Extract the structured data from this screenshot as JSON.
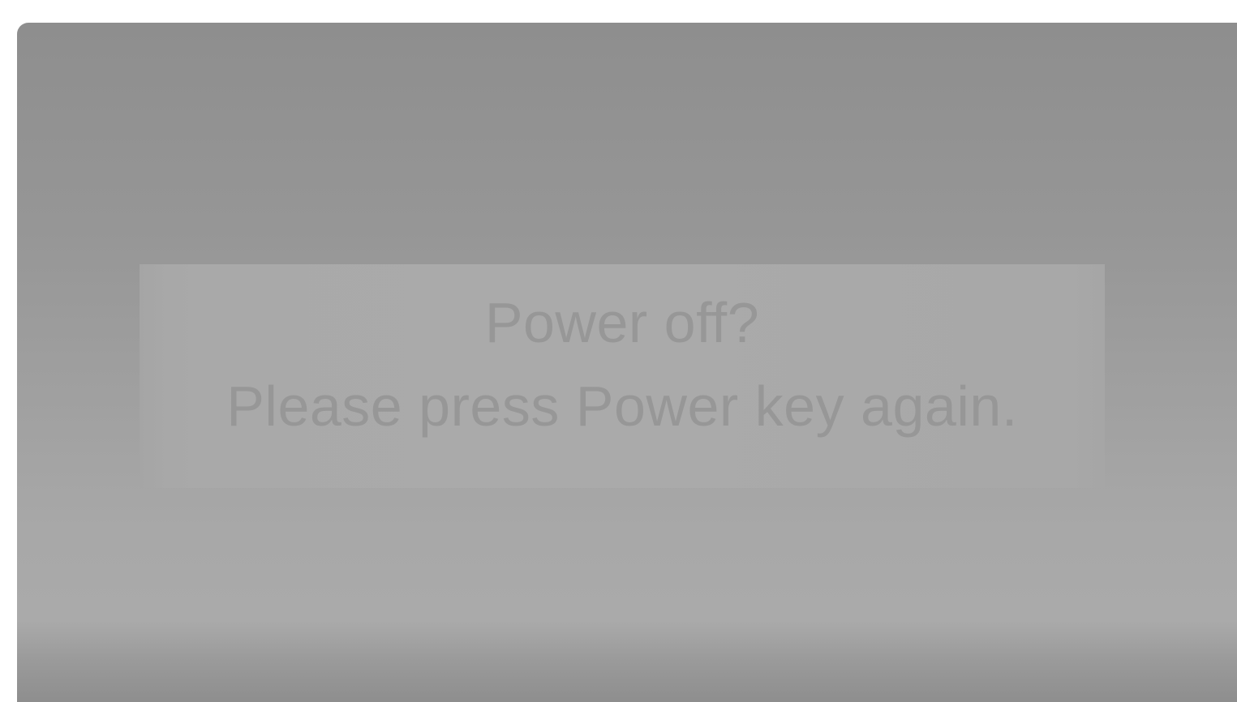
{
  "dialog": {
    "title": "Power off?",
    "message": "Please press Power key again."
  },
  "colors": {
    "page_background": "#ffffff",
    "screen_gray": "#969696",
    "dialog_background": "#aaaaaa",
    "dialog_text": "#979797"
  }
}
